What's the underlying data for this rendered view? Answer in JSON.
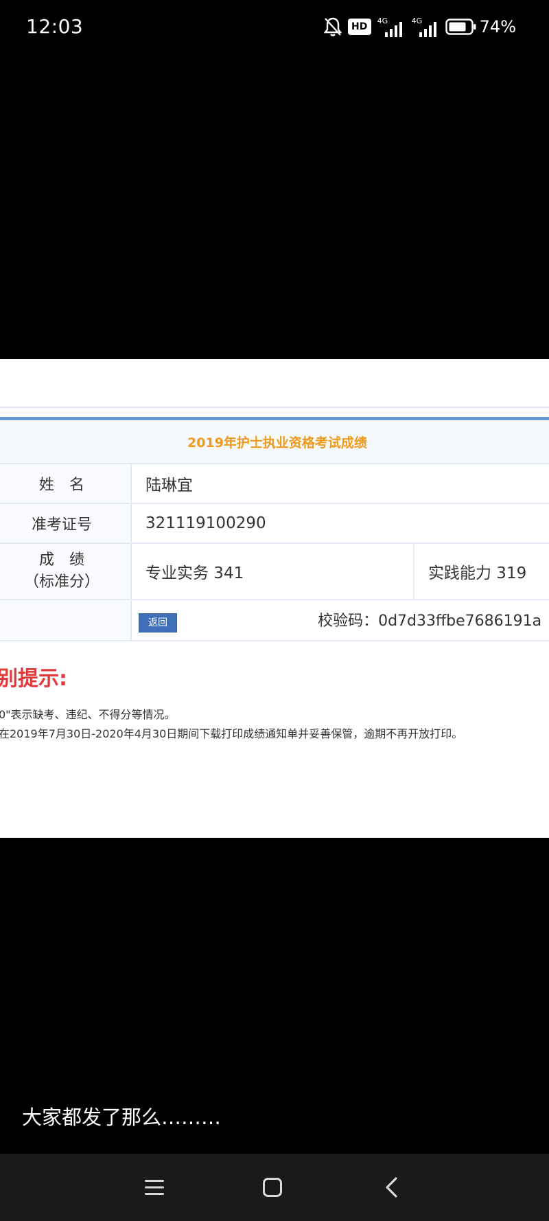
{
  "status_bar": {
    "time": "12:03",
    "hd_label": "HD",
    "net1_label": "4G",
    "net2_label": "4G",
    "battery_percent": "74%",
    "icons": [
      "mute-bell-icon",
      "hd-icon",
      "signal-icon",
      "signal-icon",
      "battery-icon"
    ]
  },
  "score_card": {
    "title": "2019年护士执业资格考试成绩",
    "name_label": "姓　名",
    "name_value": "陆琳宜",
    "ticket_label": "准考证号",
    "ticket_value": "321119100290",
    "score_label_line1": "成　绩",
    "score_label_line2": "（标准分）",
    "professional_score": "专业实务 341",
    "practice_score": "实践能力 319",
    "return_label": "返回",
    "verify_code": "校验码：0d7d33ffbe7686191a"
  },
  "notice": {
    "heading": "别提示:",
    "line1": "0\"表示缺考、违纪、不得分等情况。",
    "line2": "在2019年7月30日-2020年4月30日期间下载打印成绩通知单并妥善保管，逾期不再开放打印。"
  },
  "caption": "大家都发了那么………",
  "nav": {
    "icons": [
      "menu-icon",
      "home-square-icon",
      "back-chevron-icon"
    ]
  },
  "colors": {
    "title_orange": "#ef9a1b",
    "notice_red": "#e23b3b",
    "button_blue": "#3f6fb7",
    "accent_blue": "#6c9bd3"
  }
}
